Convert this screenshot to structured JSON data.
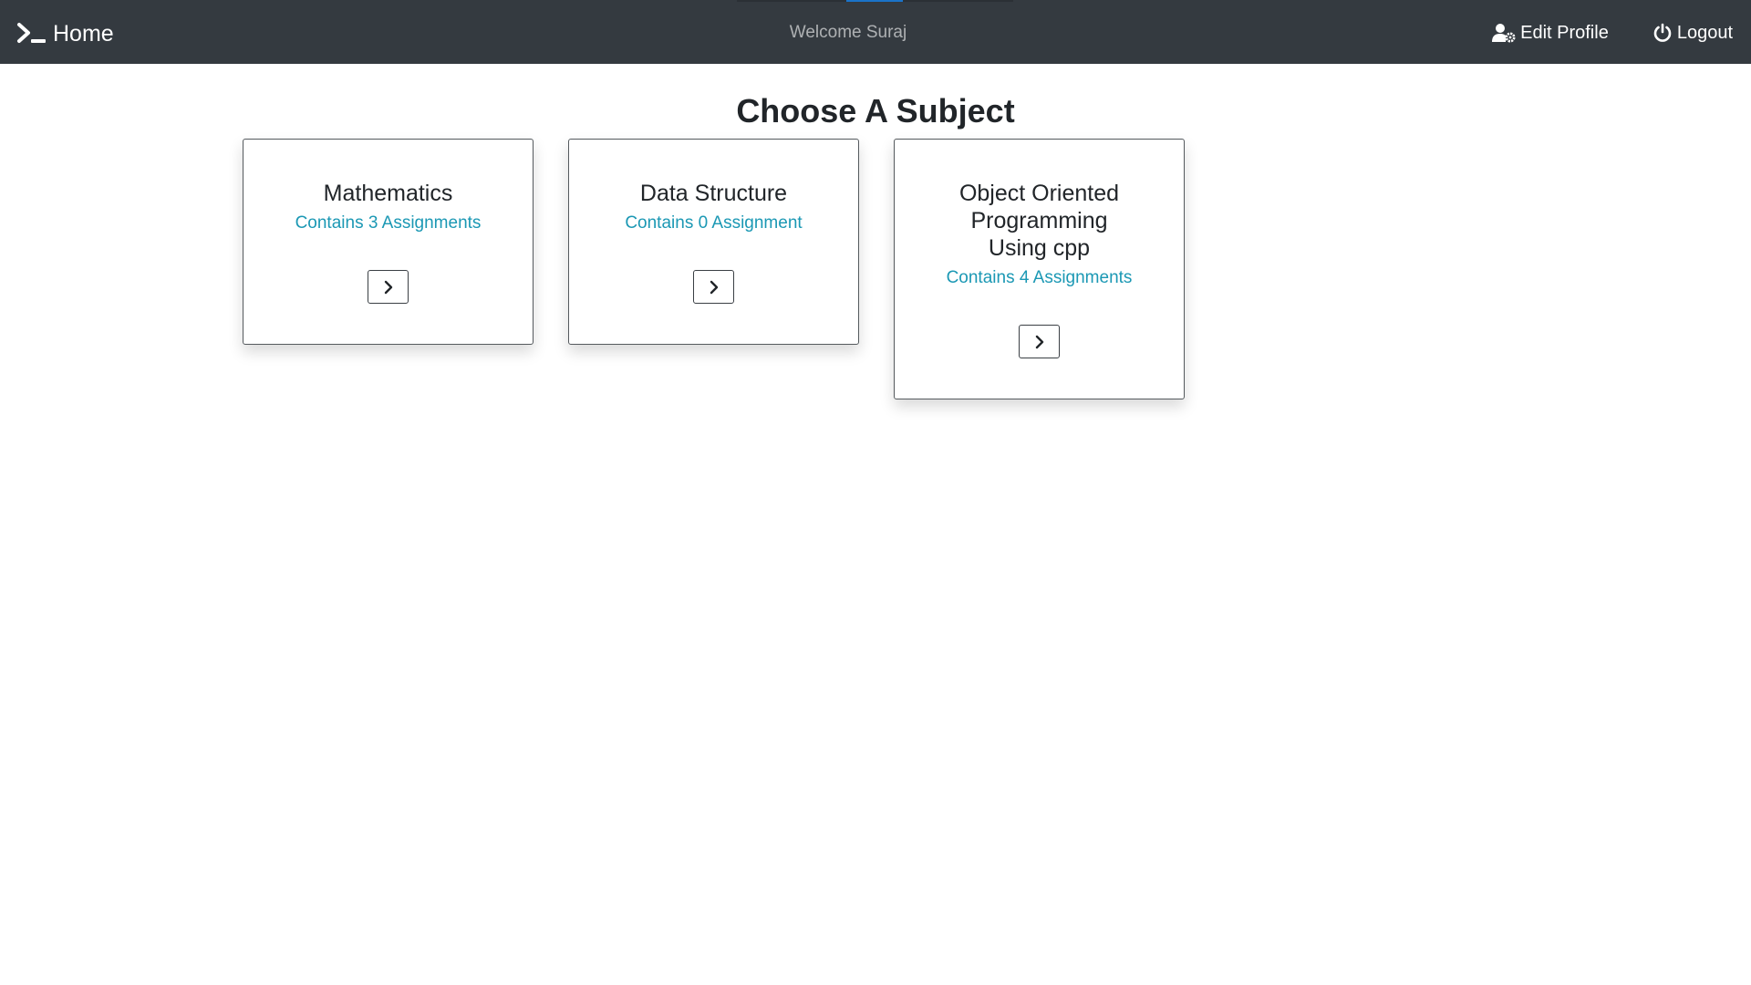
{
  "navbar": {
    "brand_label": "Home",
    "welcome_text": "Welcome Suraj",
    "edit_profile_label": "Edit Profile",
    "logout_label": "Logout",
    "background_color": "#343a40"
  },
  "page": {
    "title": "Choose A Subject"
  },
  "subjects": [
    {
      "title": "Mathematics",
      "subtitle": "Contains 3 Assignments"
    },
    {
      "title": "Data Structure",
      "subtitle": "Contains 0 Assignment"
    },
    {
      "title": "Object Oriented Programming Using cpp",
      "subtitle": "Contains 4 Assignments"
    }
  ],
  "colors": {
    "accent_teal": "#1b98b4",
    "text_dark": "#212529"
  },
  "icons": {
    "brand": "terminal-prompt-icon",
    "edit_profile": "user-cog-icon",
    "logout": "power-icon",
    "card_button": "chevron-right-icon"
  }
}
